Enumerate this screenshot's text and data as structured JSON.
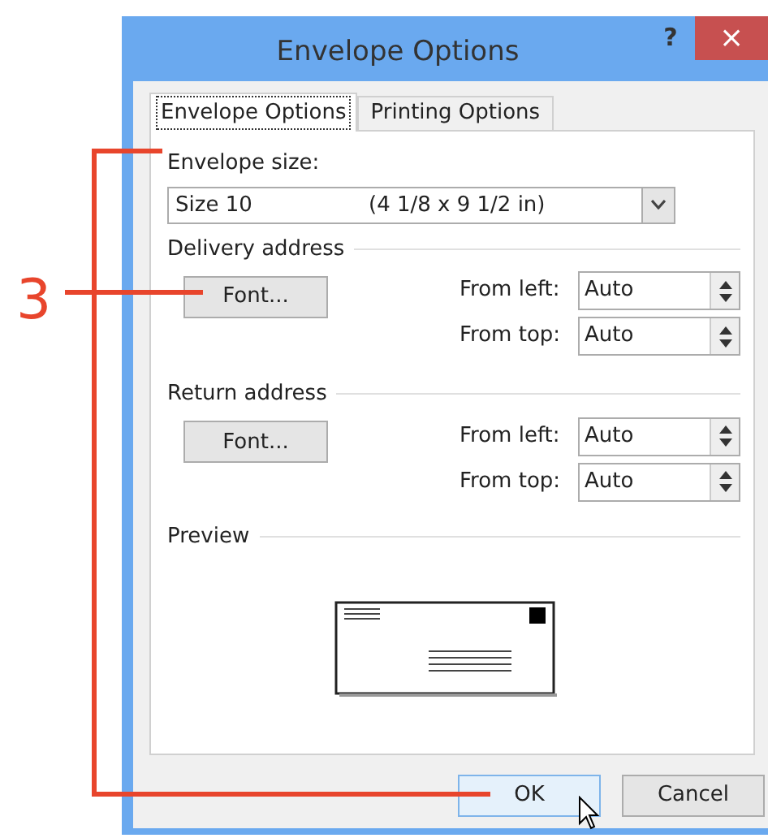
{
  "callout": {
    "label": "3"
  },
  "window": {
    "title": "Envelope Options",
    "help": "?",
    "close": "×"
  },
  "tabs": [
    {
      "label": "Envelope Options",
      "selected": true
    },
    {
      "label": "Printing Options",
      "selected": false
    }
  ],
  "envelope_size": {
    "label": "Envelope size:",
    "value": "Size 10",
    "dimensions": "(4 1/8 x 9 1/2 in)"
  },
  "sections": [
    {
      "title": "Delivery address",
      "font_button": "Font...",
      "fields": [
        {
          "label": "From left:",
          "value": "Auto"
        },
        {
          "label": "From top:",
          "value": "Auto"
        }
      ]
    },
    {
      "title": "Return address",
      "font_button": "Font...",
      "fields": [
        {
          "label": "From left:",
          "value": "Auto"
        },
        {
          "label": "From top:",
          "value": "Auto"
        }
      ]
    }
  ],
  "preview": {
    "title": "Preview"
  },
  "buttons": [
    {
      "label": "OK",
      "focused": true
    },
    {
      "label": "Cancel",
      "focused": false
    }
  ]
}
